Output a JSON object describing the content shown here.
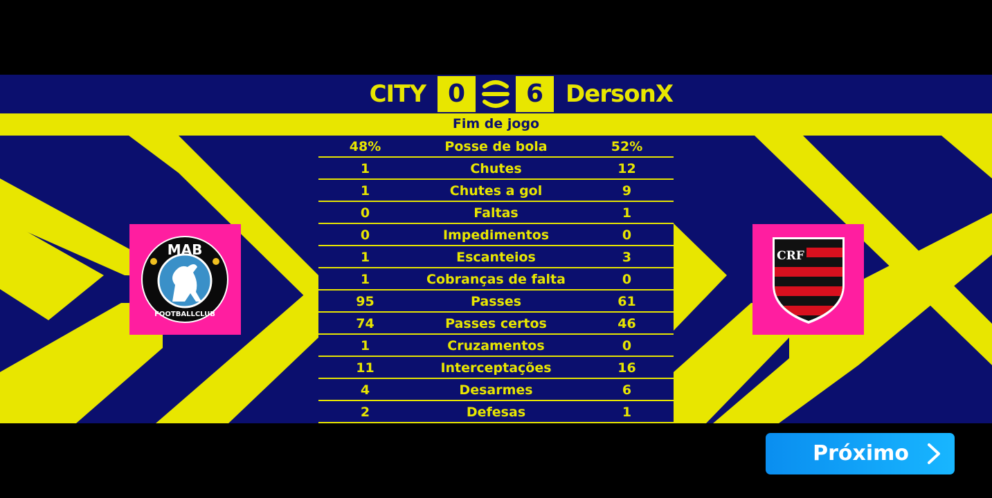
{
  "match": {
    "home_team": "CITY",
    "away_team": "DersonX",
    "home_score": "0",
    "away_score": "6",
    "status": "Fim de jogo",
    "competition_icon": "efootball-logo-icon"
  },
  "crests": {
    "home": {
      "icon": "mab-football-club-crest-icon",
      "text_top": "MAB",
      "text_bottom": "FOOTBALLCLUB"
    },
    "away": {
      "icon": "flamengo-crest-icon",
      "monogram": "CRF"
    }
  },
  "stats": [
    {
      "home": "48%",
      "label": "Posse de bola",
      "away": "52%"
    },
    {
      "home": "1",
      "label": "Chutes",
      "away": "12"
    },
    {
      "home": "1",
      "label": "Chutes a gol",
      "away": "9"
    },
    {
      "home": "0",
      "label": "Faltas",
      "away": "1"
    },
    {
      "home": "0",
      "label": "Impedimentos",
      "away": "0"
    },
    {
      "home": "1",
      "label": "Escanteios",
      "away": "3"
    },
    {
      "home": "1",
      "label": "Cobranças de falta",
      "away": "0"
    },
    {
      "home": "95",
      "label": "Passes",
      "away": "61"
    },
    {
      "home": "74",
      "label": "Passes certos",
      "away": "46"
    },
    {
      "home": "1",
      "label": "Cruzamentos",
      "away": "0"
    },
    {
      "home": "11",
      "label": "Interceptações",
      "away": "16"
    },
    {
      "home": "4",
      "label": "Desarmes",
      "away": "6"
    },
    {
      "home": "2",
      "label": "Defesas",
      "away": "1"
    }
  ],
  "next_button": {
    "label": "Próximo",
    "icon": "chevron-right-icon"
  },
  "colors": {
    "navy": "#0b0f6e",
    "yellow": "#e8e600",
    "magenta": "#ff1ea0",
    "button_blue": "#0a8ef0"
  }
}
